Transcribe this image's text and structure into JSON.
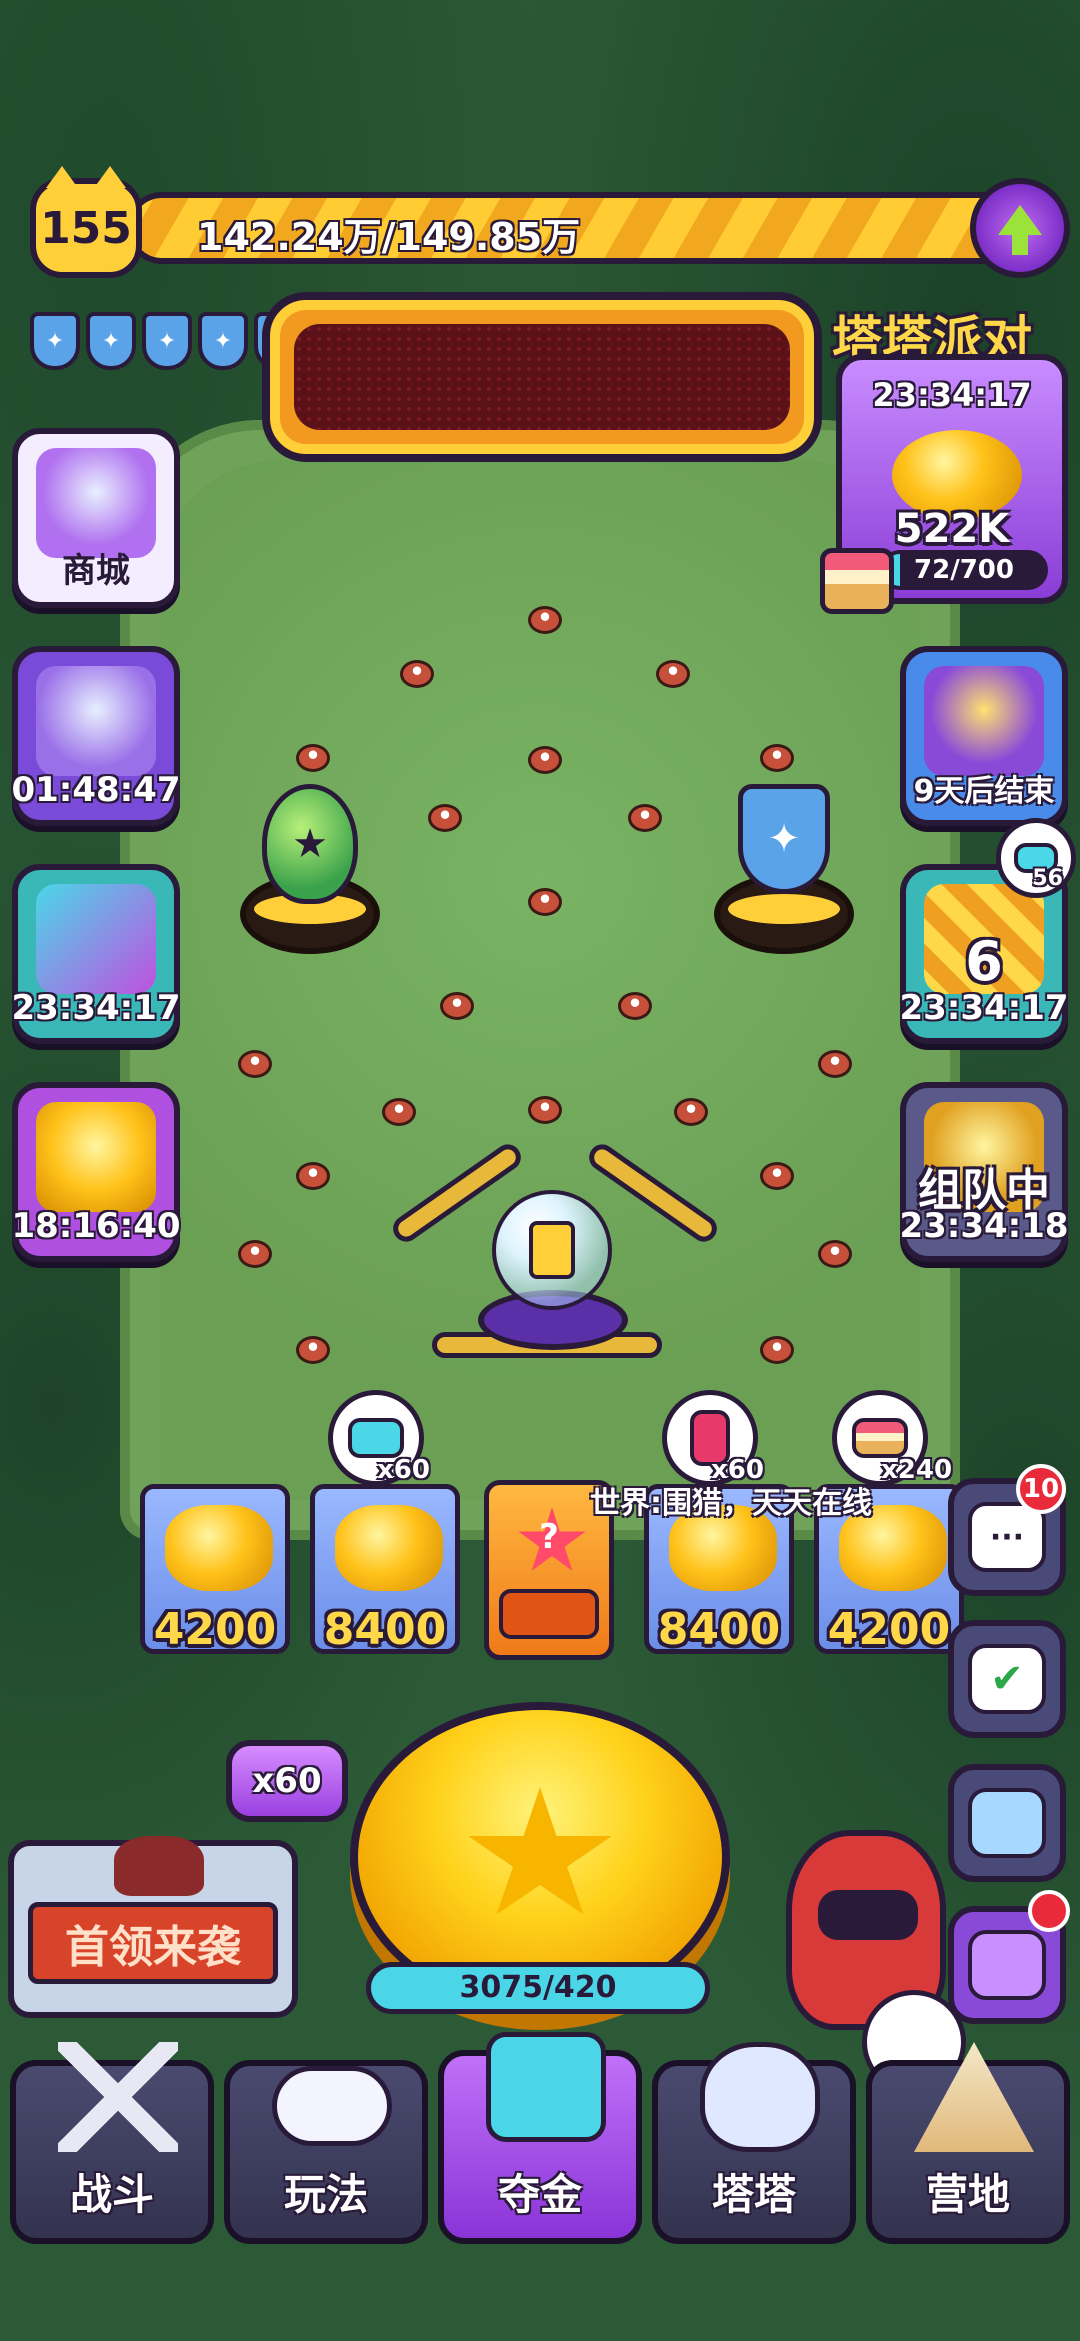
{
  "header": {
    "level": "155",
    "xp_text": "142.24万/149.85万",
    "xp_progress": 0.949,
    "shield_count": 5
  },
  "party": {
    "title": "塔塔派对",
    "timer": "23:34:17",
    "amount": "522K",
    "progress_text": "72/700",
    "progress": 0.103
  },
  "left_cards": [
    {
      "label": "商城"
    },
    {
      "label": "01:48:47"
    },
    {
      "label": "23:34:17"
    },
    {
      "label": "18:16:40"
    }
  ],
  "right_cards": [
    {
      "label": "9天后结束"
    },
    {
      "label": "23:34:17",
      "big_number": "6",
      "bubble_count": "56"
    },
    {
      "label": "23:34:18",
      "title": "组队中"
    }
  ],
  "bubbles": [
    {
      "count": "x60"
    },
    {
      "count": "x60"
    },
    {
      "count": "x240"
    }
  ],
  "slots": [
    "4200",
    "8400",
    "8400",
    "4200"
  ],
  "slot_center_symbol": "?",
  "world_chat": "世界:围猎，天天在线",
  "chat_badge": "10",
  "multiplier": "x60",
  "energy_text": "3075/420",
  "boss_label": "首领来袭",
  "nav": [
    {
      "label": "战斗"
    },
    {
      "label": "玩法"
    },
    {
      "label": "夺金"
    },
    {
      "label": "塔塔"
    },
    {
      "label": "营地"
    }
  ],
  "colors": {
    "board": "#6fa35a",
    "gold": "#ffd21a",
    "purple": "#8a34d8",
    "outline": "#2a1a3a",
    "accent_blue": "#4bd6e8"
  }
}
